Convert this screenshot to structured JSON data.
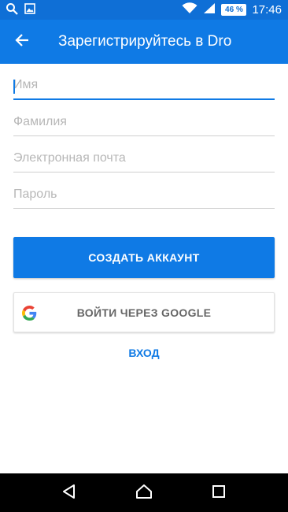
{
  "status_bar": {
    "battery": "46 %",
    "time": "17:46",
    "icons": [
      "search-icon",
      "image-icon",
      "wifi-icon",
      "signal-icon",
      "battery-icon"
    ]
  },
  "app_bar": {
    "title": "Зарегистрируйтесь в Dro",
    "back_icon": "arrow-back-icon"
  },
  "form": {
    "first_name": {
      "placeholder": "Имя",
      "value": ""
    },
    "last_name": {
      "placeholder": "Фамилия",
      "value": ""
    },
    "email": {
      "placeholder": "Электронная почта",
      "value": ""
    },
    "password": {
      "placeholder": "Пароль",
      "value": ""
    }
  },
  "actions": {
    "create_account": "СОЗДАТЬ АККАУНТ",
    "google_signin": "ВОЙТИ ЧЕРЕЗ GOOGLE",
    "login": "ВХОД"
  },
  "colors": {
    "primary": "#0f7ae5",
    "status_bar": "#0f6fd6",
    "nav_bar": "#000000"
  }
}
